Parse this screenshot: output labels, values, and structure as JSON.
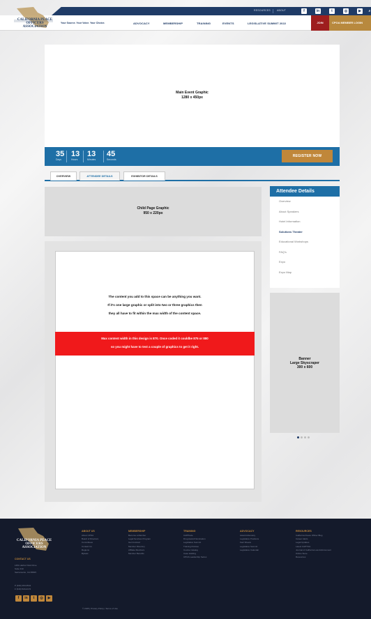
{
  "header": {
    "top_links": [
      "RESOURCES",
      "ABOUT"
    ],
    "social_icons": [
      "facebook-icon",
      "linkedin-icon",
      "twitter-icon",
      "instagram-icon",
      "youtube-icon",
      "search-icon"
    ],
    "logo": "CALIFORNIA PEACE OFFICERS ASSOCIATION",
    "tagline": "Your Source. Your Voice. Your Choice.",
    "nav": [
      "ADVOCACY",
      "MEMBERSHIP",
      "TRAINING",
      "EVENTS",
      "LEGISLATIVE SUMMIT 2022"
    ],
    "join": "JOIN",
    "login": "CPOA MEMBER LOGIN"
  },
  "hero": {
    "line1": "Main Event Graphic",
    "line2": "1280 x 450px"
  },
  "countdown": [
    {
      "value": "35",
      "label": "Days"
    },
    {
      "value": "13",
      "label": "Hours"
    },
    {
      "value": "13",
      "label": "Minutes"
    },
    {
      "value": "45",
      "label": "Seconds"
    }
  ],
  "register": "REGISTER NOW",
  "tabs": [
    "OVERVIEW",
    "ATTENDEE DETAILS",
    "EXHIBITOR DETAILS"
  ],
  "child_graphic": {
    "line1": "Child Page Graphic",
    "line2": "950 x 220px"
  },
  "content": {
    "lines": [
      "The content you add to this space can be anything you want.",
      "If it's one large graphic or split into two or three graphics then",
      "they all have to fit within the max width of the content space."
    ],
    "red_lines": [
      "Max content width in this design is 870. Once coded it couldbe 875 or 880",
      "so you might have to test a couple of graphics to get it right."
    ]
  },
  "sidebar": {
    "title": "Attendee Details",
    "items": [
      "Overview",
      "About Speakers",
      "Hotel Information",
      "Solutions Theater",
      "Educational Workshops",
      "FAQ's",
      "Expo",
      "Expo Map"
    ],
    "active_index": 3
  },
  "banner": {
    "line1": "Banner",
    "line2": "Large Skyscraper",
    "line3": "300 x 600"
  },
  "carousel": {
    "count": 4,
    "active": 0
  },
  "footer": {
    "logo": "CALIFORNIA PEACE OFFICERS ASSOCIATION",
    "contact_heading": "CONTACT US",
    "contact_lines": [
      "1451 Harbor Park Drive",
      "Suite 310",
      "Sacramento, CA 95815",
      "P (916) 263-0541",
      "F (916) 520-2172"
    ],
    "social_icons": [
      "facebook-icon",
      "linkedin-icon",
      "twitter-icon",
      "instagram-icon",
      "youtube-icon"
    ],
    "columns": [
      {
        "heading": "ABOUT US",
        "links": [
          "About CPOA",
          "Board of Directors",
          "Committees",
          "Contact Us",
          "Regions",
          "Bylaws"
        ]
      },
      {
        "heading": "MEMBERSHIP",
        "links": [
          "Become a Member",
          "Legal Services Program",
          "Get Involved",
          "Member Directory",
          "Affiliate Members",
          "Member Benefits"
        ]
      },
      {
        "heading": "TRAINING",
        "links": [
          "CAPPsule",
          "Drug Award Nomination",
          "Legislative Summit",
          "Training Policies",
          "Course Catalog",
          "Case Holding",
          "CPOA Leadership Series"
        ]
      },
      {
        "heading": "ADVOCACY",
        "links": [
          "Award Advocacy",
          "Legislative Positions",
          "Fact Sheets",
          "Legislative Summit",
          "Legislative Calendar"
        ]
      },
      {
        "heading": "RESOURCES",
        "links": [
          "California Peace Officer Blog",
          "Career Alerts",
          "Legal Updates",
          "Latest CAPTOA",
          "Journal of California Law Enforcement",
          "Online Store",
          "Resources"
        ]
      }
    ],
    "copyright": "© 2025  |  Privacy Policy  |  Terms of Use"
  }
}
